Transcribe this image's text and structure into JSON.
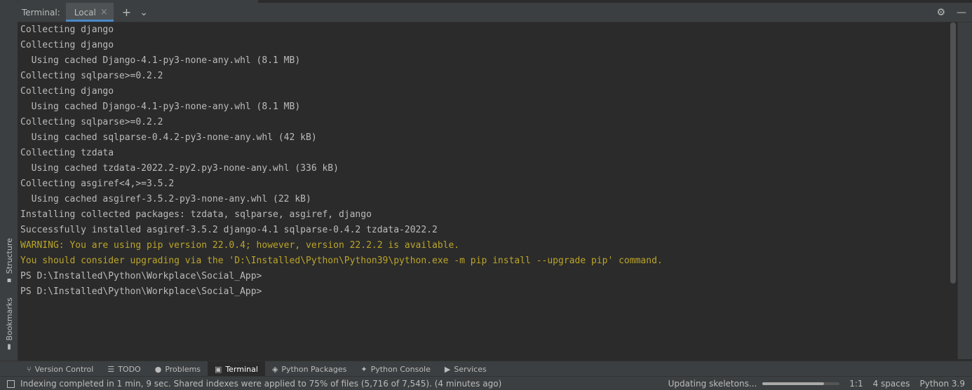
{
  "header": {
    "title": "Terminal:",
    "tab_label": "Local",
    "close_glyph": "×",
    "add_glyph": "+",
    "dropdown_glyph": "⌄",
    "settings_glyph": "⚙",
    "minimize_glyph": "—"
  },
  "left_tabs": {
    "structure": "Structure",
    "bookmarks": "Bookmarks"
  },
  "terminal_lines": [
    {
      "text": "Collecting django",
      "kind": "normal"
    },
    {
      "text": "Collecting django",
      "kind": "normal"
    },
    {
      "text": "  Using cached Django-4.1-py3-none-any.whl (8.1 MB)",
      "kind": "normal"
    },
    {
      "text": "Collecting sqlparse>=0.2.2",
      "kind": "normal"
    },
    {
      "text": "Collecting django",
      "kind": "normal"
    },
    {
      "text": "  Using cached Django-4.1-py3-none-any.whl (8.1 MB)",
      "kind": "normal"
    },
    {
      "text": "Collecting sqlparse>=0.2.2",
      "kind": "normal"
    },
    {
      "text": "  Using cached sqlparse-0.4.2-py3-none-any.whl (42 kB)",
      "kind": "normal"
    },
    {
      "text": "Collecting tzdata",
      "kind": "normal"
    },
    {
      "text": "  Using cached tzdata-2022.2-py2.py3-none-any.whl (336 kB)",
      "kind": "normal"
    },
    {
      "text": "Collecting asgiref<4,>=3.5.2",
      "kind": "normal"
    },
    {
      "text": "  Using cached asgiref-3.5.2-py3-none-any.whl (22 kB)",
      "kind": "normal"
    },
    {
      "text": "Installing collected packages: tzdata, sqlparse, asgiref, django",
      "kind": "normal"
    },
    {
      "text": "Successfully installed asgiref-3.5.2 django-4.1 sqlparse-0.4.2 tzdata-2022.2",
      "kind": "normal"
    },
    {
      "text": "WARNING: You are using pip version 22.0.4; however, version 22.2.2 is available.",
      "kind": "warn"
    },
    {
      "text": "You should consider upgrading via the 'D:\\Installed\\Python\\Python39\\python.exe -m pip install --upgrade pip' command.",
      "kind": "warn"
    },
    {
      "text": "PS D:\\Installed\\Python\\Workplace\\Social_App>",
      "kind": "normal"
    },
    {
      "text": "PS D:\\Installed\\Python\\Workplace\\Social_App>",
      "kind": "normal"
    }
  ],
  "toolbar": {
    "items": [
      {
        "label": "Version Control",
        "icon": "branch-icon",
        "glyph": "⑂",
        "active": false
      },
      {
        "label": "TODO",
        "icon": "list-icon",
        "glyph": "☰",
        "active": false
      },
      {
        "label": "Problems",
        "icon": "problems-icon",
        "glyph": "●",
        "active": false
      },
      {
        "label": "Terminal",
        "icon": "terminal-icon",
        "glyph": "▣",
        "active": true
      },
      {
        "label": "Python Packages",
        "icon": "layers-icon",
        "glyph": "◈",
        "active": false
      },
      {
        "label": "Python Console",
        "icon": "python-icon",
        "glyph": "✦",
        "active": false
      },
      {
        "label": "Services",
        "icon": "services-icon",
        "glyph": "▶",
        "active": false
      }
    ]
  },
  "status": {
    "message": "Indexing completed in 1 min, 9 sec. Shared indexes were applied to 75% of files (5,716 of 7,545). (4 minutes ago)",
    "task_label": "Updating skeletons...",
    "progress_fraction": 0.8,
    "position": "1:1",
    "indent": "4 spaces",
    "interpreter": "Python 3.9"
  },
  "colors": {
    "accent": "#4a88c7",
    "warning_text": "#bba529"
  }
}
